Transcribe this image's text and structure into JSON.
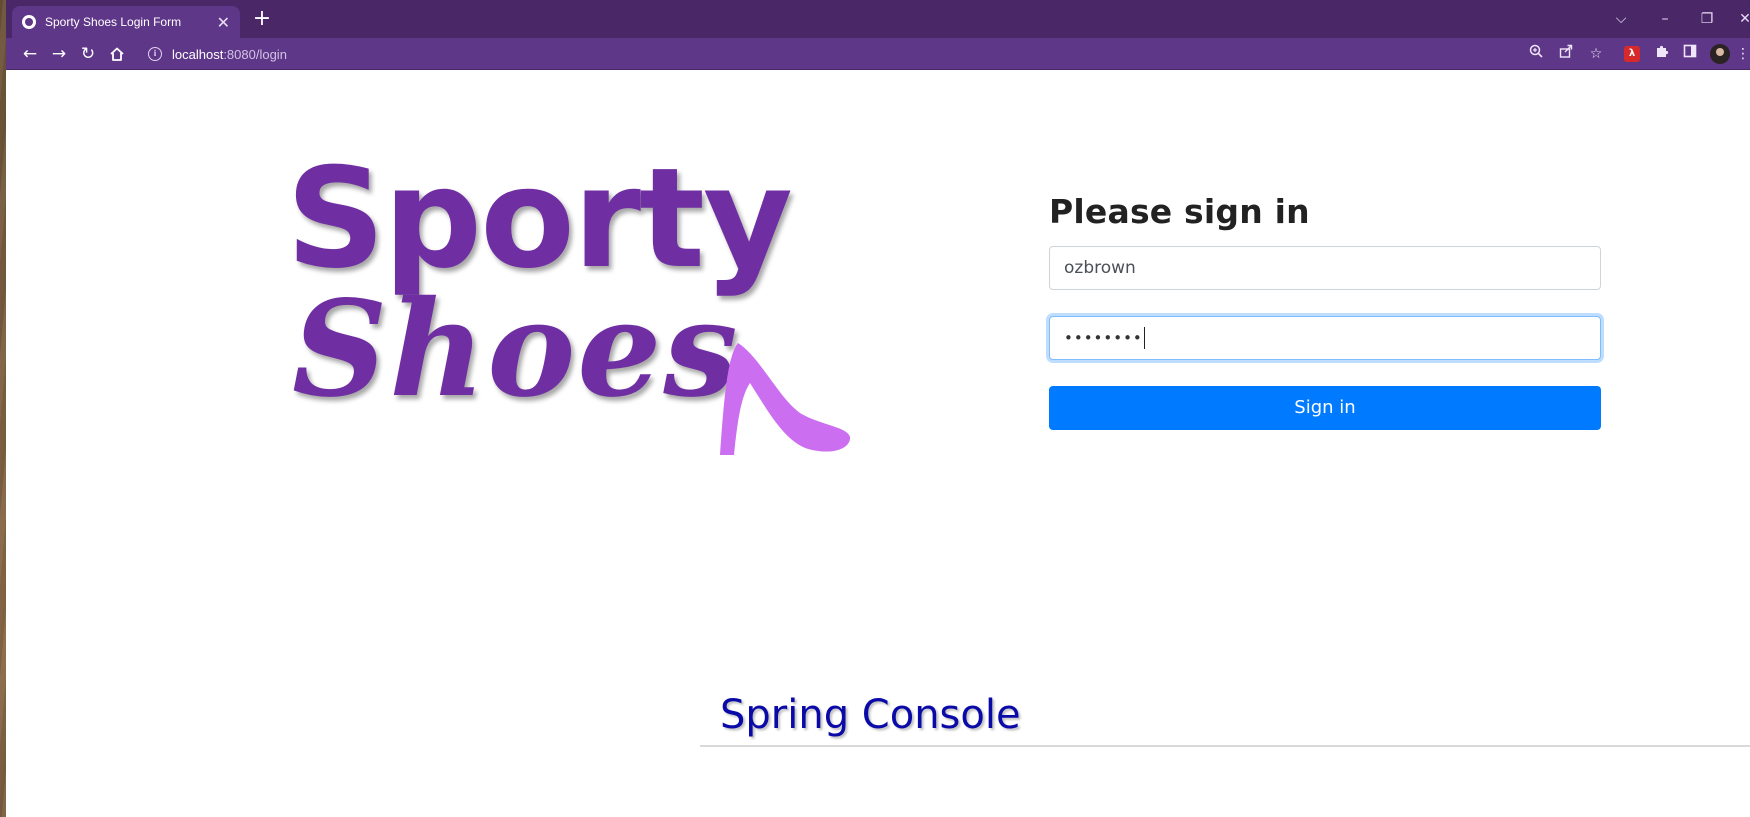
{
  "browser": {
    "tab_title": "Sporty Shoes Login Form",
    "tab_close": "✕",
    "new_tab": "+",
    "url_host": "localhost",
    "url_rest": ":8080/login",
    "win_dropdown": "⌵",
    "win_minimize": "–",
    "win_restore": "❐",
    "win_close": "✕",
    "icons": [
      "back-icon",
      "forward-icon",
      "reload-icon",
      "home-icon",
      "info-icon",
      "zoom-icon",
      "share-icon",
      "star-icon",
      "pdf-icon",
      "extensions-icon",
      "sidepanel-icon",
      "avatar",
      "menu-icon"
    ],
    "theme_color": "#5f3788"
  },
  "logo": {
    "line1": "Sporty",
    "line2": "Shoes",
    "color": "#6f2fa3",
    "shoe_color": "#cc6ef0"
  },
  "login": {
    "heading": "Please sign in",
    "username_value": "ozbrown",
    "password_mask": "••••••••",
    "submit_label": "Sign in",
    "button_color": "#007bff"
  },
  "footer": {
    "caption": "Spring Console",
    "caption_color": "#0a0aa8"
  }
}
